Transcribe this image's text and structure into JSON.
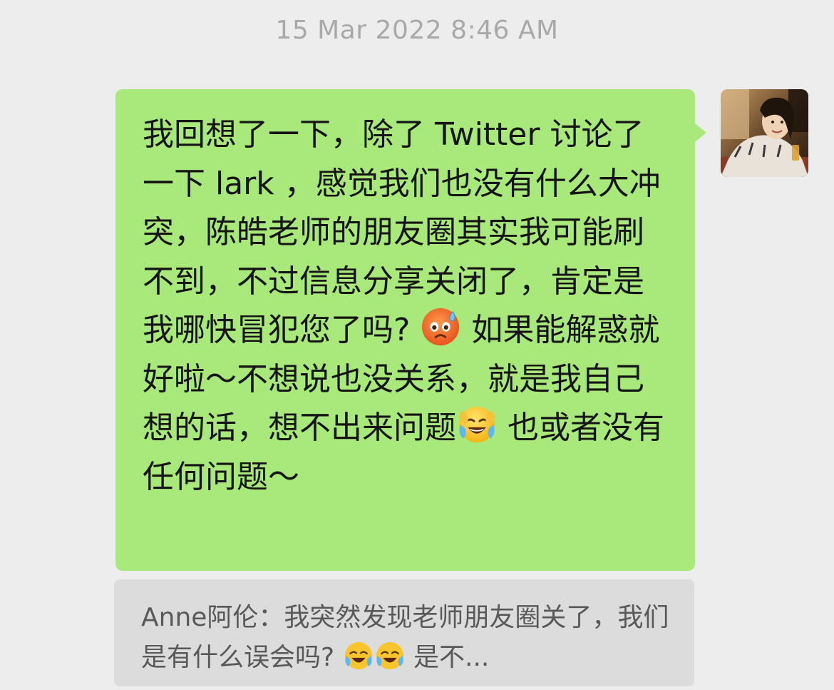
{
  "timestamp": "15 Mar 2022 8:46 AM",
  "message": {
    "segment_1": "我回想了一下，除了 Twitter 讨论了一下 lark ，感觉我们也没有什么大冲突，陈皓老师的朋友圈其实我可能刷不到，不过信息分享关闭了，肯定是我哪快冒犯您了吗? ",
    "segment_2": " 如果能解惑就好啦～不想说也没关系，就是我自己想的话，想不出来问题",
    "segment_3": " 也或者没有任何问题～",
    "emoji_1": "anxious-sweat-face",
    "emoji_2": "laughing-tears-face"
  },
  "quote": {
    "text_1": "Anne阿伦：我突然发现老师朋友圈关了，我们是有什么误会吗? ",
    "text_2": " 是不...",
    "emoji": "laughing-tears-face"
  },
  "colors": {
    "background": "#ededed",
    "bubble_green": "#a9e87a",
    "quote_gray": "#dcdcdc",
    "timestamp_gray": "#a9a9a9"
  }
}
